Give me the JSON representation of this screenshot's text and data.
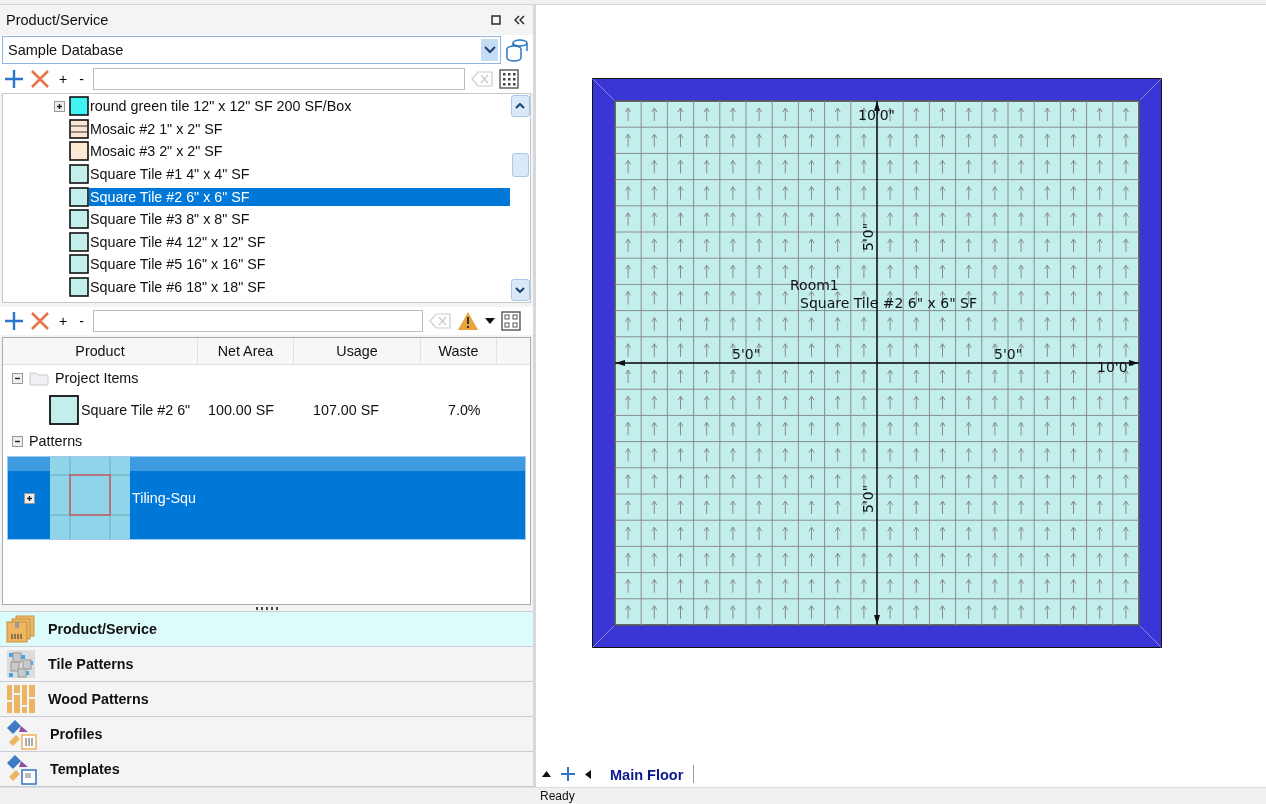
{
  "panel": {
    "title": "Product/Service"
  },
  "database": {
    "value": "Sample Database"
  },
  "catalog": {
    "items": [
      {
        "label": "round green tile 12\" x 12\" SF 200 SF/Box",
        "color": "#40f4f4",
        "kind": "plain",
        "expanded": false,
        "selected": false
      },
      {
        "label": "Mosaic #2 1\" x 2\" SF",
        "color": "#fbe7d2",
        "kind": "striped",
        "selected": false
      },
      {
        "label": "Mosaic #3 2\" x 2\" SF",
        "color": "#fde8d4",
        "kind": "plain",
        "selected": false
      },
      {
        "label": "Square Tile #1 4\" x 4\" SF",
        "color": "#c2efec",
        "kind": "plain",
        "selected": false
      },
      {
        "label": "Square Tile #2 6\" x 6\" SF",
        "color": "#c2efec",
        "kind": "plain",
        "selected": true
      },
      {
        "label": "Square Tile #3 8\" x 8\" SF",
        "color": "#c2efec",
        "kind": "plain",
        "selected": false
      },
      {
        "label": "Square Tile #4 12\" x 12\" SF",
        "color": "#c2efec",
        "kind": "plain",
        "selected": false
      },
      {
        "label": "Square Tile #5 16\" x 16\" SF",
        "color": "#c2efec",
        "kind": "plain",
        "selected": false
      },
      {
        "label": "Square Tile #6 18\" x 18\" SF",
        "color": "#c2efec",
        "kind": "plain",
        "selected": false
      }
    ]
  },
  "toolbars": [
    {
      "expand": "+",
      "collapse": "-",
      "warning": false
    },
    {
      "expand": "+",
      "collapse": "-",
      "warning": true
    }
  ],
  "project_table": {
    "columns": [
      "Product",
      "Net Area",
      "Usage",
      "Waste"
    ],
    "groups": [
      {
        "label": "Project Items",
        "kind": "items",
        "expanded": true,
        "rows": [
          {
            "product": "Square Tile #2 6\"",
            "net_area": "100.00 SF",
            "usage": "107.00 SF",
            "waste": "7.0%",
            "color": "#c2efec"
          }
        ]
      },
      {
        "label": "Patterns",
        "kind": "patterns",
        "expanded": true,
        "patterns": [
          {
            "label": "Tiling-Squ",
            "selected": true,
            "expanded": false
          }
        ]
      }
    ]
  },
  "nav": [
    {
      "label": "Product/Service",
      "kind": "boxes",
      "selected": true
    },
    {
      "label": "Tile Patterns",
      "kind": "tiles",
      "selected": false
    },
    {
      "label": "Wood Patterns",
      "kind": "wood",
      "selected": false
    },
    {
      "label": "Profiles",
      "kind": "profile",
      "selected": false
    },
    {
      "label": "Templates",
      "kind": "template",
      "selected": false
    }
  ],
  "drawing": {
    "room_name": "Room1",
    "material": "Square Tile #2 6\" x 6\" SF",
    "top_width": "10'0\"",
    "upper_height": "5'0\"",
    "left_width": "5'0\"",
    "right_width": "5'0\"",
    "right_total": "10'0\"",
    "lower_height": "5'0\""
  },
  "floor_tabs": [
    {
      "label": "Main Floor",
      "selected": true
    }
  ],
  "status_bar": {
    "text": "Ready"
  }
}
